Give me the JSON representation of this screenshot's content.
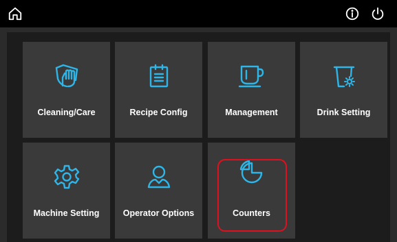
{
  "header": {
    "home_icon": "home-icon",
    "info_icon": "info-icon",
    "power_icon": "power-icon"
  },
  "tiles": [
    {
      "label": "Cleaning/Care",
      "icon": "hand-wash-icon"
    },
    {
      "label": "Recipe Config",
      "icon": "clipboard-icon"
    },
    {
      "label": "Management",
      "icon": "cup-icon"
    },
    {
      "label": "Drink Setting",
      "icon": "cup-gear-icon"
    },
    {
      "label": "Machine Setting",
      "icon": "gear-icon"
    },
    {
      "label": "Operator Options",
      "icon": "user-icon"
    },
    {
      "label": "Counters",
      "icon": "pie-chart-icon"
    }
  ],
  "colors": {
    "accent": "#2fb6e8",
    "tile_bg": "#3a3a3a",
    "highlight": "#e0101e"
  }
}
